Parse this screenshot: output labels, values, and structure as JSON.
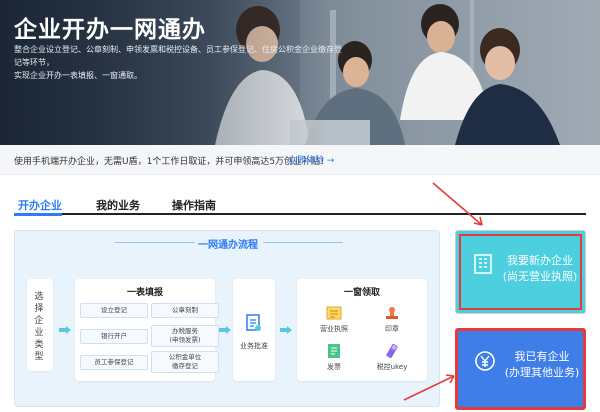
{
  "banner": {
    "title": "企业开办一网通办",
    "desc_line1": "整合企业设立登记、公章刻制、申领发票和税控设备、员工参保登记、住房公积金企业缴存登记等环节，",
    "desc_line2": "实现企业开办一表填报、一窗通取。"
  },
  "notice": {
    "text": "使用手机端开办企业，无需U盾，1个工作日取证，并可申领高达5万创业补贴！",
    "link": "立即体验 →"
  },
  "tabs": [
    {
      "label": "开办企业",
      "active": true
    },
    {
      "label": "我的业务",
      "active": false
    },
    {
      "label": "操作指南",
      "active": false
    }
  ],
  "flow": {
    "title": "一网通办流程",
    "step1": "选择企业类型",
    "step2": {
      "title": "一表填报",
      "items": [
        "设立登记",
        "公章刻制",
        "银行开户",
        "办税服务\n(申领发票)",
        "员工参保登记",
        "公积金单位\n缴存登记"
      ]
    },
    "step3": "业务批准",
    "step4": {
      "title": "一窗领取",
      "items": [
        {
          "label": "营业执照",
          "icon": "license-icon"
        },
        {
          "label": "印章",
          "icon": "seal-icon"
        },
        {
          "label": "发票",
          "icon": "invoice-icon"
        },
        {
          "label": "税控ukey",
          "icon": "ukey-icon"
        }
      ]
    }
  },
  "cards": {
    "new_line1": "我要新办企业",
    "new_line2": "(尚无营业执照)",
    "have_line1": "我已有企业",
    "have_line2": "(办理其他业务)"
  },
  "colors": {
    "accent": "#2f7cf6",
    "new_card": "#4ecfe0",
    "have_card": "#3f7de9",
    "highlight": "#e53a3a"
  }
}
